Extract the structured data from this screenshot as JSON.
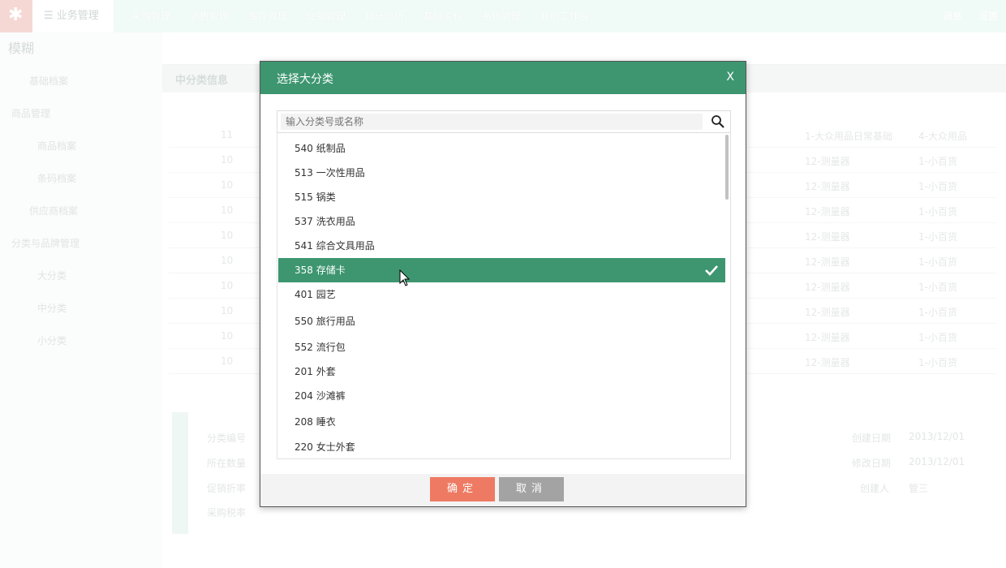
{
  "topnav": {
    "home": "业务管理",
    "items": [
      "采购管理",
      "销售管理",
      "库存管理",
      "促销管理",
      "统计分析",
      "基础资料",
      "系统管理",
      "我的工作台"
    ],
    "right": [
      "消息",
      "设置"
    ]
  },
  "sidebar": {
    "title": "模糊",
    "items": [
      {
        "label": "基础档案",
        "level": "sub"
      },
      {
        "label": "商品管理",
        "level": "grp"
      },
      {
        "label": "商品档案",
        "level": "sub"
      },
      {
        "label": "条码档案",
        "level": "sub"
      },
      {
        "label": "供应商档案",
        "level": "item"
      },
      {
        "label": "分类与品牌管理",
        "level": "grp"
      },
      {
        "label": "大分类",
        "level": "sub"
      },
      {
        "label": "中分类",
        "level": "sub"
      },
      {
        "label": "小分类",
        "level": "sub"
      }
    ]
  },
  "tab": {
    "label": "中分类信息"
  },
  "bg_rows": [
    {
      "a": "11",
      "b": "1-大众用品日常基础",
      "c": "4-大众用品"
    },
    {
      "a": "10",
      "b": "12-测量器",
      "c": "1-小百货"
    },
    {
      "a": "10",
      "b": "12-测量器",
      "c": "1-小百货"
    },
    {
      "a": "10",
      "b": "12-测量器",
      "c": "1-小百货"
    },
    {
      "a": "10",
      "b": "12-测量器",
      "c": "1-小百货"
    },
    {
      "a": "10",
      "b": "12-测量器",
      "c": "1-小百货"
    },
    {
      "a": "10",
      "b": "12-测量器",
      "c": "1-小百货"
    },
    {
      "a": "10",
      "b": "12-测量器",
      "c": "1-小百货"
    },
    {
      "a": "10",
      "b": "12-测量器",
      "c": "1-小百货"
    },
    {
      "a": "10",
      "b": "12-测量器",
      "c": "1-小百货"
    }
  ],
  "bg_form": {
    "left": [
      "分类编号",
      "所在数量",
      "促销折率",
      "采购税率"
    ],
    "right_labels": [
      "创建日期",
      "修改日期",
      "创建人"
    ],
    "right_values": [
      "2013/12/01",
      "2013/12/01",
      "管三"
    ]
  },
  "modal": {
    "title": "选择大分类",
    "close": "X",
    "search_placeholder": "输入分类号或名称",
    "items": [
      {
        "code": "540",
        "name": "纸制品",
        "label": "540 纸制品"
      },
      {
        "code": "513",
        "name": "一次性用品",
        "label": "513 一次性用品"
      },
      {
        "code": "515",
        "name": "锅类",
        "label": "515 锅类"
      },
      {
        "code": "537",
        "name": "洗衣用品",
        "label": "537 洗衣用品"
      },
      {
        "code": "541",
        "name": "综合文具用品",
        "label": "541 综合文具用品"
      },
      {
        "code": "358",
        "name": "存储卡",
        "label": "358 存储卡",
        "selected": true
      },
      {
        "code": "401",
        "name": "园艺",
        "label": "401 园艺"
      },
      {
        "code": "550",
        "name": "旅行用品",
        "label": "550 旅行用品"
      },
      {
        "code": "552",
        "name": "流行包",
        "label": "552 流行包"
      },
      {
        "code": "201",
        "name": "外套",
        "label": "201 外套"
      },
      {
        "code": "204",
        "name": "沙滩裤",
        "label": "204 沙滩裤"
      },
      {
        "code": "208",
        "name": "睡衣",
        "label": "208 睡衣"
      },
      {
        "code": "220",
        "name": "女士外套",
        "label": "220 女士外套"
      }
    ],
    "ok_label": "确定",
    "cancel_label": "取消"
  },
  "colors": {
    "primary": "#3d9670",
    "ok": "#ef7a63",
    "cancel": "#a3a3a3"
  }
}
